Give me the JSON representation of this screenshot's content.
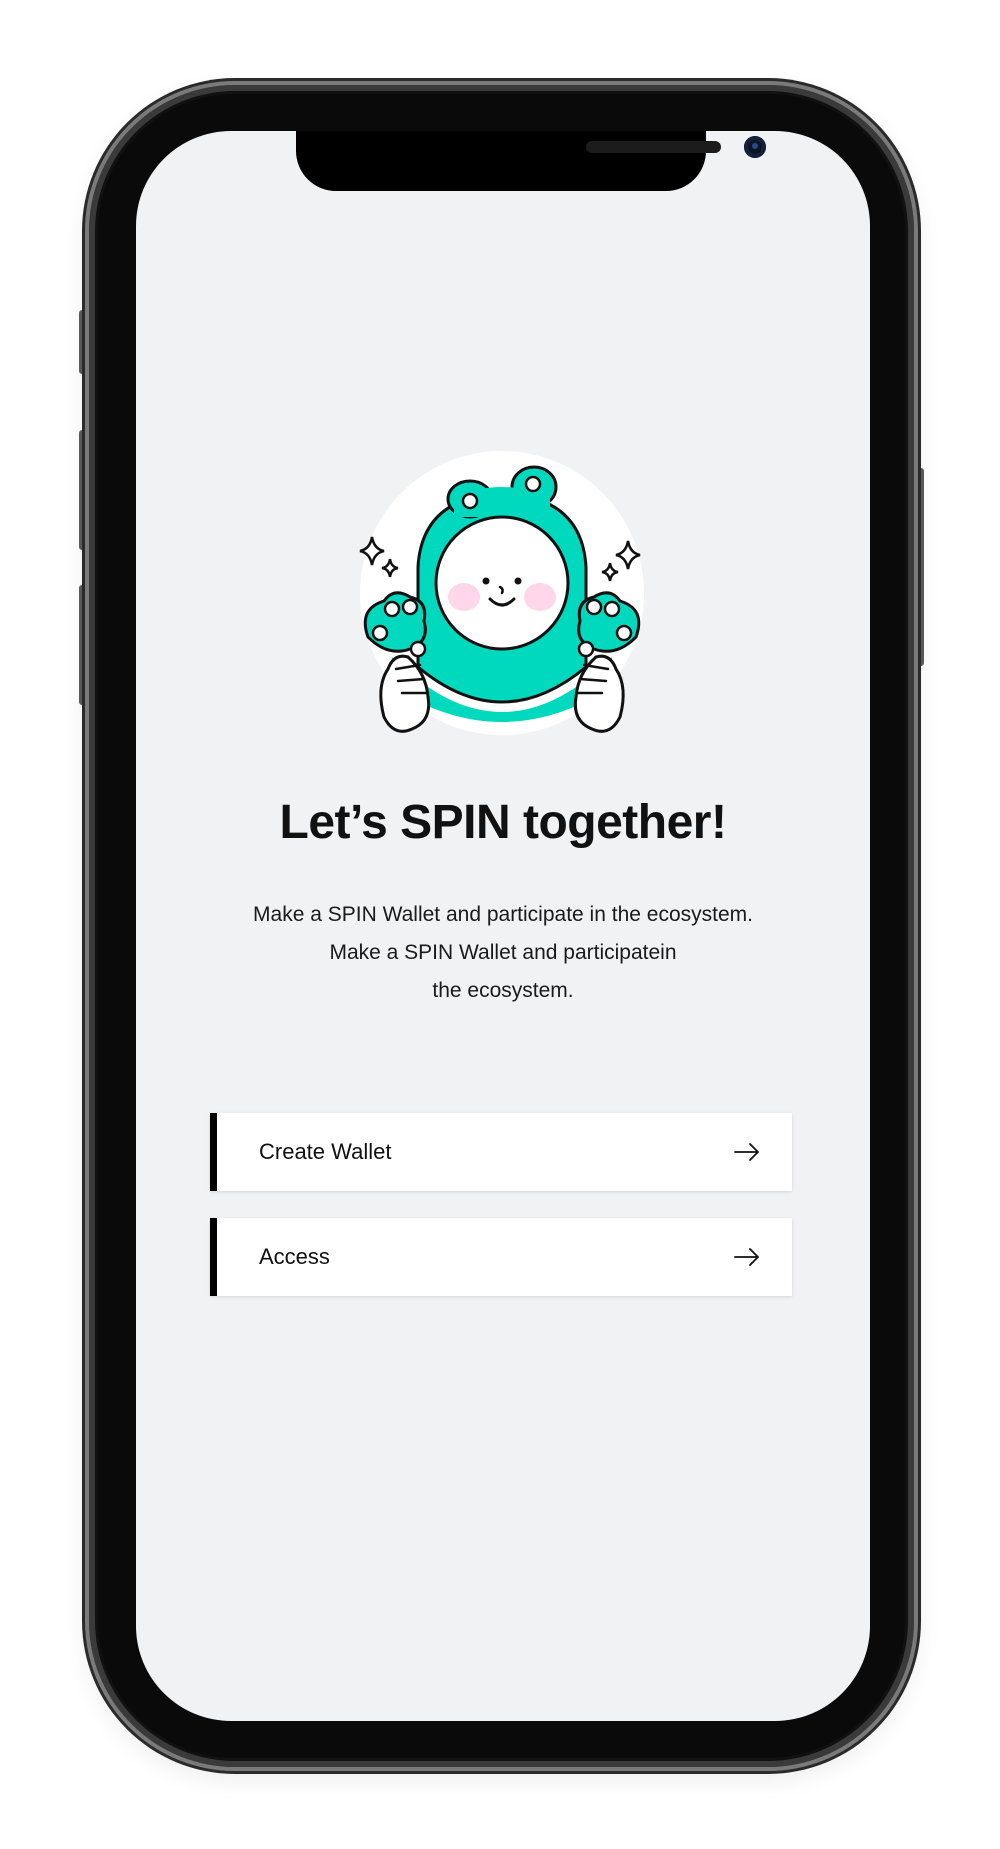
{
  "screen": {
    "headline": "Let’s SPIN together!",
    "description": "Make a SPIN Wallet and participate in the ecosystem.\nMake a SPIN Wallet and participatein\nthe ecosystem.",
    "actions": [
      {
        "label": "Create Wallet",
        "icon": "arrow-right-icon"
      },
      {
        "label": "Access",
        "icon": "arrow-right-icon"
      }
    ]
  },
  "colors": {
    "accent": "#00d9bd",
    "background": "#f1f2f4",
    "button_border": "#000000"
  }
}
